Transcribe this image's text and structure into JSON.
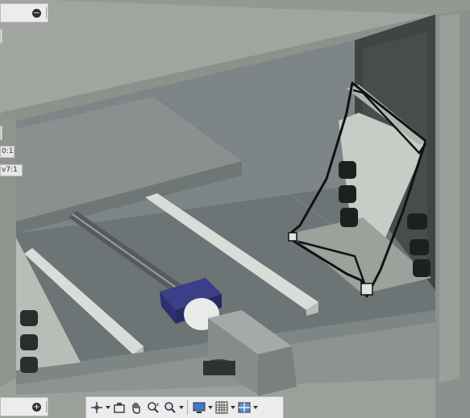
{
  "scale_labels": {
    "label_1": "0:1",
    "label_2": "v7:1"
  },
  "panels": {
    "top_button_icon": "minus-circle-icon",
    "top_button_glyph": "−",
    "bottom_button_icon": "plus-circle-icon",
    "bottom_button_glyph": "+"
  },
  "navbar": {
    "tools": [
      {
        "name": "pan-orbit-icon"
      },
      {
        "name": "look-at-icon"
      },
      {
        "name": "pan-hand-icon"
      },
      {
        "name": "zoom-realtime-icon"
      },
      {
        "name": "zoom-window-icon"
      },
      {
        "name": "display-settings-icon"
      },
      {
        "name": "grid-icon"
      },
      {
        "name": "viewports-icon"
      }
    ]
  },
  "colors": {
    "background": "#8f9590",
    "accent_blue": "#2c3070",
    "sketch_line": "#111111"
  }
}
